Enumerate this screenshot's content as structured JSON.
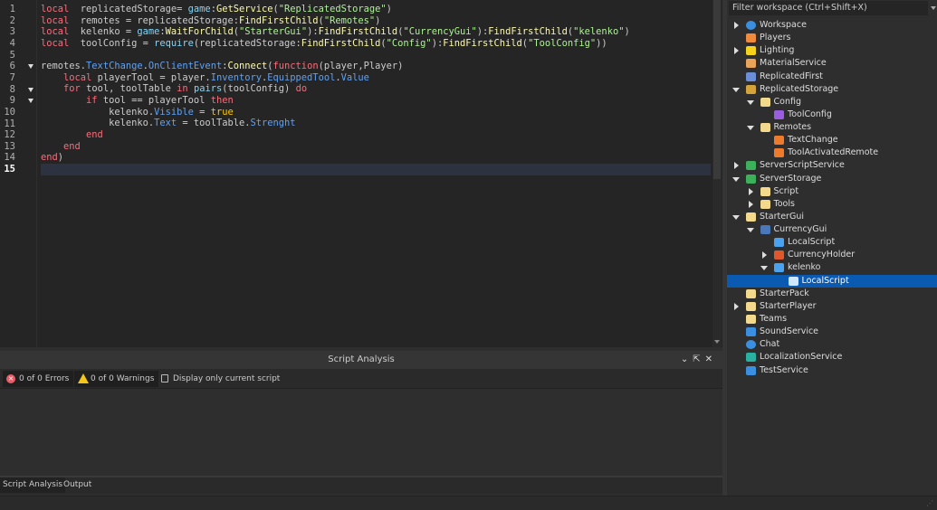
{
  "editor": {
    "current_line": 15,
    "folded_lines": [
      6,
      8,
      9
    ],
    "lines": [
      [
        [
          "kw",
          "local"
        ],
        [
          "",
          "  replicatedStorage= "
        ],
        [
          "bi",
          "game"
        ],
        [
          "",
          ":"
        ],
        [
          "me",
          "GetService"
        ],
        [
          "",
          "("
        ],
        [
          "st",
          "\"ReplicatedStorage\""
        ],
        [
          "",
          ")"
        ]
      ],
      [
        [
          "kw",
          "local"
        ],
        [
          "",
          "  remotes = replicatedStorage:"
        ],
        [
          "me",
          "FindFirstChild"
        ],
        [
          "",
          "("
        ],
        [
          "st",
          "\"Remotes\""
        ],
        [
          "",
          ")"
        ]
      ],
      [
        [
          "kw",
          "local"
        ],
        [
          "",
          "  kelenko = "
        ],
        [
          "bi",
          "game"
        ],
        [
          "",
          ":"
        ],
        [
          "me",
          "WaitForChild"
        ],
        [
          "",
          "("
        ],
        [
          "st",
          "\"StarterGui\""
        ],
        [
          "",
          "):"
        ],
        [
          "me",
          "FindFirstChild"
        ],
        [
          "",
          "("
        ],
        [
          "st",
          "\"CurrencyGui\""
        ],
        [
          "",
          "):"
        ],
        [
          "me",
          "FindFirstChild"
        ],
        [
          "",
          "("
        ],
        [
          "st",
          "\"kelenko\""
        ],
        [
          "",
          ")"
        ]
      ],
      [
        [
          "kw",
          "local"
        ],
        [
          "",
          "  toolConfig = "
        ],
        [
          "bi",
          "require"
        ],
        [
          "",
          "(replicatedStorage:"
        ],
        [
          "me",
          "FindFirstChild"
        ],
        [
          "",
          "("
        ],
        [
          "st",
          "\"Config\""
        ],
        [
          "",
          "):"
        ],
        [
          "me",
          "FindFirstChild"
        ],
        [
          "",
          "("
        ],
        [
          "st",
          "\"ToolConfig\""
        ],
        [
          "",
          "))"
        ]
      ],
      [],
      [
        [
          "",
          "remotes."
        ],
        [
          "pr",
          "TextChange"
        ],
        [
          "",
          "."
        ],
        [
          "pr",
          "OnClientEvent"
        ],
        [
          "",
          ":"
        ],
        [
          "me",
          "Connect"
        ],
        [
          "",
          "("
        ],
        [
          "kw",
          "function"
        ],
        [
          "",
          "(player,Player)"
        ]
      ],
      [
        [
          "",
          "    "
        ],
        [
          "kw",
          "local"
        ],
        [
          "",
          " playerTool = player."
        ],
        [
          "pr",
          "Inventory"
        ],
        [
          "",
          "."
        ],
        [
          "pr",
          "EquippedTool"
        ],
        [
          "",
          "."
        ],
        [
          "pr",
          "Value"
        ]
      ],
      [
        [
          "",
          "    "
        ],
        [
          "kw",
          "for"
        ],
        [
          "",
          "",
          " tool, toolTable "
        ],
        [
          "kw",
          "in"
        ],
        [
          "",
          " "
        ],
        [
          "bi",
          "pairs"
        ],
        [
          "",
          "(toolConfig) "
        ],
        [
          "kw",
          "do"
        ]
      ],
      [
        [
          "",
          "        "
        ],
        [
          "kw",
          "if"
        ],
        [
          "",
          " tool == playerTool "
        ],
        [
          "kw",
          "then"
        ]
      ],
      [
        [
          "",
          "            kelenko."
        ],
        [
          "pr",
          "Visible"
        ],
        [
          "",
          " = "
        ],
        [
          "bo",
          "true"
        ]
      ],
      [
        [
          "",
          "            kelenko."
        ],
        [
          "pr",
          "Text"
        ],
        [
          "",
          " = toolTable."
        ],
        [
          "pr",
          "Strenght"
        ]
      ],
      [
        [
          "",
          "        "
        ],
        [
          "kw",
          "end"
        ]
      ],
      [
        [
          "",
          "    "
        ],
        [
          "kw",
          "end"
        ]
      ],
      [
        [
          "kw",
          "end"
        ],
        [
          "",
          ")"
        ]
      ],
      []
    ]
  },
  "explorer": {
    "filter_placeholder": "Filter workspace (Ctrl+Shift+X)",
    "items": [
      {
        "label": "Workspace",
        "level": 0,
        "exp": "c",
        "icon": "globe-icon",
        "color": "#3b8fe0"
      },
      {
        "label": "Players",
        "level": 0,
        "exp": "",
        "icon": "players-icon",
        "color": "#f08a3c"
      },
      {
        "label": "Lighting",
        "level": 0,
        "exp": "c",
        "icon": "lightbulb-icon",
        "color": "#f5d31a"
      },
      {
        "label": "MaterialService",
        "level": 0,
        "exp": "",
        "icon": "material-service-icon",
        "color": "#e8a55a"
      },
      {
        "label": "ReplicatedFirst",
        "level": 0,
        "exp": "",
        "icon": "replicated-first-icon",
        "color": "#6b8fd6"
      },
      {
        "label": "ReplicatedStorage",
        "level": 0,
        "exp": "o",
        "icon": "replicated-storage-icon",
        "color": "#d4a43a"
      },
      {
        "label": "Config",
        "level": 1,
        "exp": "o",
        "icon": "folder-icon",
        "color": "#f2d98c"
      },
      {
        "label": "ToolConfig",
        "level": 2,
        "exp": "",
        "icon": "module-script-icon",
        "color": "#9a5de0"
      },
      {
        "label": "Remotes",
        "level": 1,
        "exp": "o",
        "icon": "folder-icon",
        "color": "#f2d98c"
      },
      {
        "label": "TextChange",
        "level": 2,
        "exp": "",
        "icon": "remote-event-icon",
        "color": "#f07a2c"
      },
      {
        "label": "ToolActivatedRemote",
        "level": 2,
        "exp": "",
        "icon": "remote-event-icon",
        "color": "#f07a2c"
      },
      {
        "label": "ServerScriptService",
        "level": 0,
        "exp": "c",
        "icon": "server-script-service-icon",
        "color": "#3cb05a"
      },
      {
        "label": "ServerStorage",
        "level": 0,
        "exp": "o",
        "icon": "server-storage-icon",
        "color": "#3cb05a"
      },
      {
        "label": "Script",
        "level": 1,
        "exp": "c",
        "icon": "folder-icon",
        "color": "#f2d98c"
      },
      {
        "label": "Tools",
        "level": 1,
        "exp": "c",
        "icon": "folder-icon",
        "color": "#f2d98c"
      },
      {
        "label": "StarterGui",
        "level": 0,
        "exp": "o",
        "icon": "starter-gui-icon",
        "color": "#f2d98c"
      },
      {
        "label": "CurrencyGui",
        "level": 1,
        "exp": "o",
        "icon": "screen-gui-icon",
        "color": "#4a78b8"
      },
      {
        "label": "LocalScript",
        "level": 2,
        "exp": "",
        "icon": "local-script-icon",
        "color": "#4aa3f0"
      },
      {
        "label": "CurrencyHolder",
        "level": 2,
        "exp": "c",
        "icon": "frame-icon",
        "color": "#e2562c"
      },
      {
        "label": "kelenko",
        "level": 2,
        "exp": "o",
        "icon": "text-label-icon",
        "color": "#4aa3f0"
      },
      {
        "label": "LocalScript",
        "level": 3,
        "exp": "",
        "icon": "local-script-icon",
        "color": "#cfe6ff",
        "selected": true
      },
      {
        "label": "StarterPack",
        "level": 0,
        "exp": "",
        "icon": "starter-pack-icon",
        "color": "#f2d98c"
      },
      {
        "label": "StarterPlayer",
        "level": 0,
        "exp": "c",
        "icon": "starter-player-icon",
        "color": "#f2d98c"
      },
      {
        "label": "Teams",
        "level": 0,
        "exp": "",
        "icon": "teams-icon",
        "color": "#f2d98c"
      },
      {
        "label": "SoundService",
        "level": 0,
        "exp": "",
        "icon": "sound-icon",
        "color": "#3b8fe0"
      },
      {
        "label": "Chat",
        "level": 0,
        "exp": "",
        "icon": "chat-icon",
        "color": "#3b8fe0"
      },
      {
        "label": "LocalizationService",
        "level": 0,
        "exp": "",
        "icon": "localization-icon",
        "color": "#2ab0a0"
      },
      {
        "label": "TestService",
        "level": 0,
        "exp": "",
        "icon": "test-service-icon",
        "color": "#3b8fe0"
      }
    ]
  },
  "bottom_panel": {
    "title": "Script Analysis",
    "errors": "0 of 0 Errors",
    "warnings": "0 of 0 Warnings",
    "display_only_current": "Display only current script",
    "tabs": [
      "Script Analysis",
      "Output"
    ]
  }
}
